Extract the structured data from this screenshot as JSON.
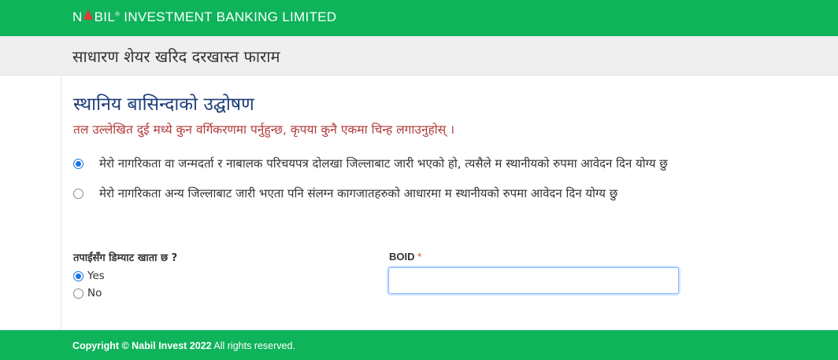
{
  "header": {
    "brand_n": "N",
    "brand_rest": "BIL",
    "brand_reg": "®",
    "brand_suffix": " INVESTMENT BANKING LIMITED",
    "brand_colors": {
      "bar": "#0eb35a",
      "triangle": "#e53935"
    }
  },
  "subheader": {
    "title": "साधारण शेयर खरिद दरखास्त फाराम"
  },
  "declaration": {
    "title": "स्थानिय बासिन्दाको उद्घोषण",
    "note": "तल उल्लेखित दुई मध्ये कुन वर्गिकरणमा पर्नुहुन्छ, कृपया कुनै एकमा चिन्ह लगाउनुहोस् ।",
    "options": [
      {
        "label": "मेरो नागरिकता वा जन्मदर्ता र नाबालक परिचयपत्र दोलखा जिल्लाबाट जारी भएको हो, त्यसैले म स्थानीयको रुपमा आवेदन दिन योग्य छु",
        "checked": true
      },
      {
        "label": "मेरो नागरिकता अन्य जिल्लाबाट जारी भएता पनि संलग्न कागजातहरुको आधारमा म स्थानीयको रुपमा आवेदन दिन योग्य छु",
        "checked": false
      }
    ]
  },
  "demat": {
    "question": "तपाईंसँग डिम्याट खाता छ ?",
    "options": [
      {
        "label": "Yes",
        "checked": true
      },
      {
        "label": "No",
        "checked": false
      }
    ]
  },
  "boid": {
    "label": "BOID",
    "required_mark": "*",
    "value": ""
  },
  "footer": {
    "prefix": "Copyright © Nabil Invest 2022",
    "suffix": " All rights reserved."
  }
}
